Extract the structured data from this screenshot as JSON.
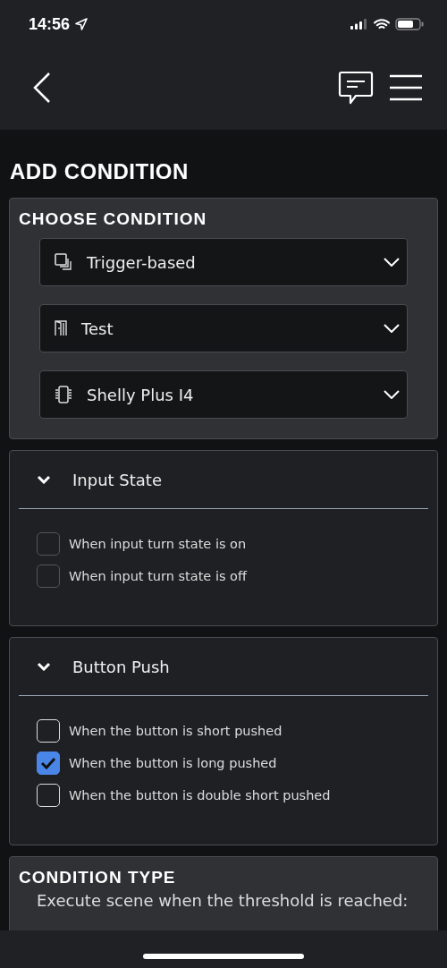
{
  "status_bar": {
    "time": "14:56"
  },
  "title": "ADD CONDITION",
  "choose_condition": {
    "heading": "CHOOSE CONDITION",
    "selects": [
      {
        "kind": "trigger",
        "value": "Trigger-based"
      },
      {
        "kind": "room",
        "value": "Test"
      },
      {
        "kind": "device",
        "value": "Shelly Plus I4"
      }
    ]
  },
  "sections": [
    {
      "title": "Input State",
      "expanded": true,
      "options": [
        {
          "label": "When input turn state is on",
          "checked": false
        },
        {
          "label": "When input turn state is off",
          "checked": false
        }
      ]
    },
    {
      "title": "Button Push",
      "expanded": true,
      "options": [
        {
          "label": "When the button is short pushed",
          "checked": false
        },
        {
          "label": "When the button is long pushed",
          "checked": true
        },
        {
          "label": "When the button is double short pushed",
          "checked": false
        }
      ]
    }
  ],
  "condition_type": {
    "heading": "CONDITION TYPE",
    "text": "Execute scene when the threshold is reached:"
  }
}
